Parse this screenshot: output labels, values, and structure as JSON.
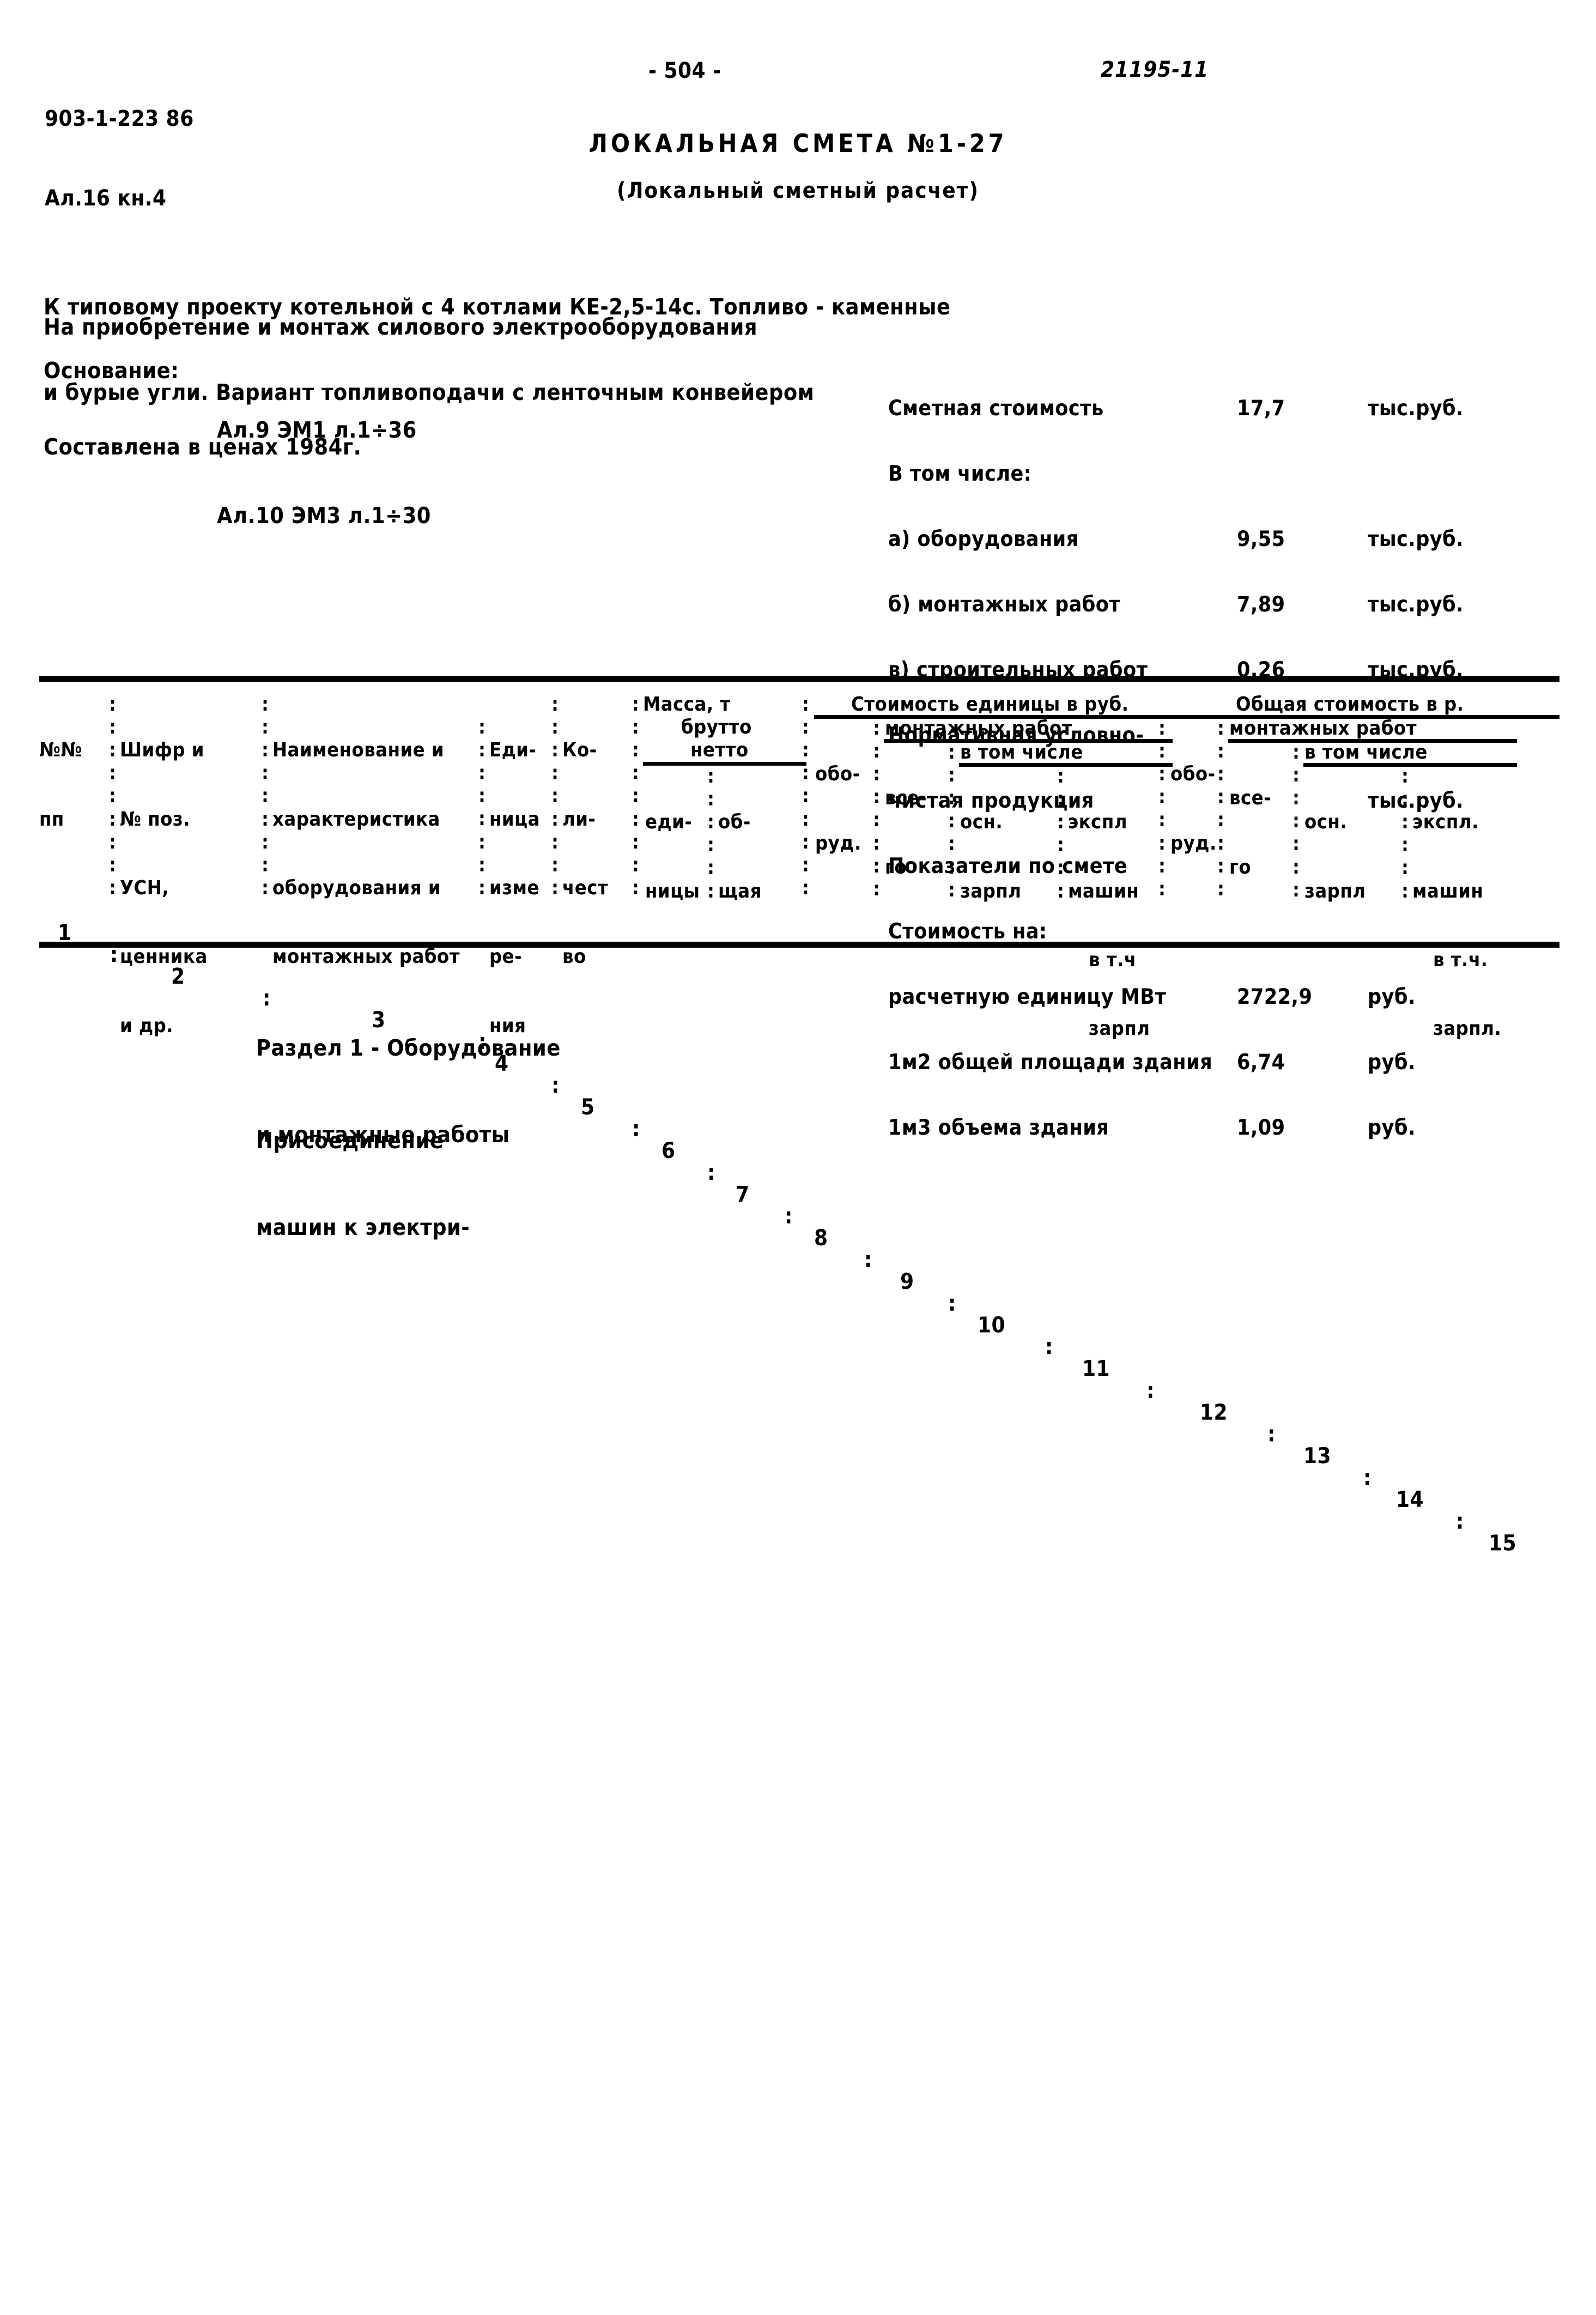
{
  "header": {
    "doc_code_line1": "903-1-223 86",
    "doc_code_line2": "Ал.16 кн.4",
    "page_folio": "- 504 -",
    "sheet_code": "21195-11"
  },
  "title": {
    "main": "ЛОКАЛЬНАЯ СМЕТА №1-27",
    "sub": "(Локальный сметный расчет)"
  },
  "intro": {
    "project_line1": "К типовому проекту котельной с 4 котлами КЕ-2,5-14с. Топливо - каменные",
    "project_line2": "и бурые угли. Вариант топливоподачи с ленточным конвейером",
    "purpose": "На приобретение и монтаж силового электрооборудования",
    "basis_label": "Основание:",
    "basis_line1": "Ал.9 ЭМ1 л.1÷36",
    "basis_line2": "Ал.10 ЭМ3 л.1÷30",
    "prices_note": "Составлена в ценах 1984г."
  },
  "summary": {
    "rows": [
      {
        "label": "Сметная стоимость",
        "value": "17,7",
        "unit": "тыс.руб."
      },
      {
        "label": "В том числе:",
        "value": "",
        "unit": ""
      },
      {
        "label": "а) оборудования",
        "value": "9,55",
        "unit": "тыс.руб."
      },
      {
        "label": "б) монтажных работ",
        "value": "7,89",
        "unit": "тыс.руб."
      },
      {
        "label": "в) строительных работ",
        "value": "0,26",
        "unit": "тыс.руб."
      },
      {
        "label": "Нормативная условно-",
        "value": "",
        "unit": ""
      },
      {
        "label": "чистая продукция",
        "value": "",
        "unit": "тыс.руб."
      },
      {
        "label": "Показатели по смете",
        "value": "",
        "unit": ""
      },
      {
        "label": "Стоимость на:",
        "value": "",
        "unit": ""
      },
      {
        "label": "расчетную единицу МВт",
        "value": "2722,9",
        "unit": "руб."
      },
      {
        "label": "1м2 общей площади здания",
        "value": "6,74",
        "unit": "руб."
      },
      {
        "label": "1м3 объема здания",
        "value": "1,09",
        "unit": "руб."
      }
    ]
  },
  "table": {
    "head": {
      "c1_l1": "№№",
      "c1_l2": "пп",
      "c2_l1": "Шифр и",
      "c2_l2": "№ поз.",
      "c2_l3": "УСН,",
      "c2_l4": "ценника",
      "c2_l5": "и др.",
      "c3_l1": "Наименование и",
      "c3_l2": "характеристика",
      "c3_l3": "оборудования и",
      "c3_l4": "монтажных работ",
      "c4_l1": "Еди-",
      "c4_l2": "ница",
      "c4_l3": "изме",
      "c4_l4": "ре-",
      "c4_l5": "ния",
      "c5_l1": "Ко-",
      "c5_l2": "ли-",
      "c5_l3": "чест",
      "c5_l4": "во",
      "c67_title": "Масса, т",
      "c67_brutto": "брутто",
      "c67_netto": "нетто",
      "c6_l1": "еди-",
      "c6_l2": "ницы",
      "c7_l1": "об-",
      "c7_l2": "щая",
      "unit_cost_title": "Стоимость единицы в руб.",
      "c8_l1": "обо-",
      "c8_l2": "руд.",
      "mont_works_a": "монтажных работ",
      "c9_l1": "все-",
      "c9_l2": "го",
      "v_tom_chisle_a": "в том числе",
      "c10_l1": "осн.",
      "c10_l2": "зарпл",
      "c11_l1": "экспл",
      "c11_l2": "машин",
      "c11_l3": "в т.ч",
      "c11_l4": "зарпл",
      "total_cost_title": "Общая стоимость в р.",
      "c12_l1": "обо-",
      "c12_l2": "руд.",
      "mont_works_b": "монтажных работ",
      "c13_l1": "все-",
      "c13_l2": "го",
      "v_tom_chisle_b": "в том числе",
      "c14_l1": "осн.",
      "c14_l2": "зарпл",
      "c15_l1": "экспл.",
      "c15_l2": "машин",
      "c15_l3": "в т.ч.",
      "c15_l4": "зарпл."
    },
    "column_numbers": [
      "1",
      "2",
      "3",
      "4",
      "5",
      "6",
      "7",
      "8",
      "9",
      "10",
      "11",
      "12",
      "13",
      "14",
      "15"
    ]
  },
  "body": {
    "section_line1": "Раздел 1 - Оборудование",
    "section_line2": "и монтажные работы",
    "item_line1": "Присоединение",
    "item_line2": "машин к электри-"
  },
  "colon": ":"
}
